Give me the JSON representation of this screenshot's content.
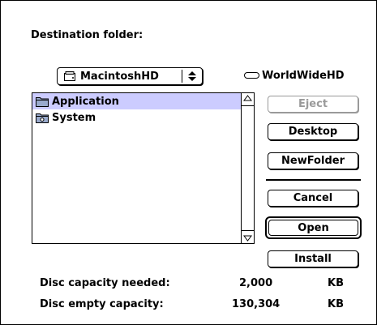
{
  "dialog": {
    "title": "Destination folder:"
  },
  "volume_popup": {
    "selected": "MacintoshHD",
    "icon": "disk-icon"
  },
  "volume_label": {
    "name": "WorldWideHD",
    "icon": "drive-icon"
  },
  "file_list": {
    "items": [
      {
        "name": "Application",
        "icon": "folder-icon",
        "selected": true
      },
      {
        "name": "System",
        "icon": "system-folder-icon",
        "selected": false
      }
    ]
  },
  "buttons": {
    "eject": "Eject",
    "desktop": "Desktop",
    "new_folder": "NewFolder",
    "cancel": "Cancel",
    "open": "Open",
    "install": "Install"
  },
  "capacity": {
    "needed_label": "Disc capacity needed:",
    "needed_value": "2,000",
    "needed_unit": "KB",
    "empty_label": "Disc empty capacity:",
    "empty_value": "130,304",
    "empty_unit": "KB"
  },
  "colors": {
    "selection": "#ccccff",
    "disabled_text": "#9a9a9a"
  }
}
